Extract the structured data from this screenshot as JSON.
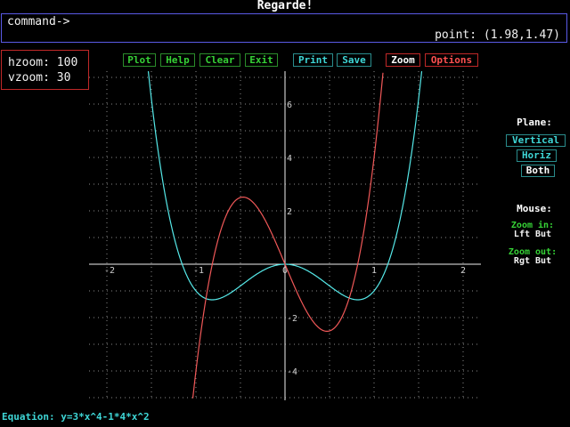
{
  "window": {
    "title": "Regarde!"
  },
  "command": {
    "prompt": "command->",
    "point": "point: (1.98,1.47)"
  },
  "zoom": {
    "hzoom": "hzoom: 100",
    "vzoom": "vzoom: 30"
  },
  "toolbar": {
    "plot": "Plot",
    "help": "Help",
    "clear": "Clear",
    "exit": "Exit",
    "print": "Print",
    "save": "Save",
    "zoom": "Zoom",
    "options": "Options"
  },
  "plane": {
    "heading": "Plane:",
    "vertical": "Vertical",
    "horiz": "Horiz",
    "both": "Both",
    "selected": "Both"
  },
  "mouse": {
    "heading": "Mouse:",
    "zoom_in": "Zoom in:",
    "zoom_in_button": "Lft But",
    "zoom_out": "Zoom out:",
    "zoom_out_button": "Rgt But"
  },
  "equation": "Equation: y=3*x^4-1*4*x^2",
  "chart_data": {
    "type": "line",
    "x_ticks": [
      "-2",
      "-1",
      "0",
      "1",
      "2"
    ],
    "y_ticks": [
      "6",
      "4",
      "2",
      "-2",
      "-4"
    ],
    "xlim": [
      -2.0,
      2.0
    ],
    "ylim": [
      -5.1,
      7.2
    ],
    "grid": true,
    "series": [
      {
        "function": "3*x^4-4*x^2",
        "color": "#55e8e8"
      },
      {
        "function": "12*x^3-8*x",
        "color": "#f05858"
      }
    ]
  },
  "colors": {
    "green": "#36d236",
    "cyan": "#3ed6d6",
    "red": "#ff5050",
    "blue": "#5a5ae6"
  }
}
